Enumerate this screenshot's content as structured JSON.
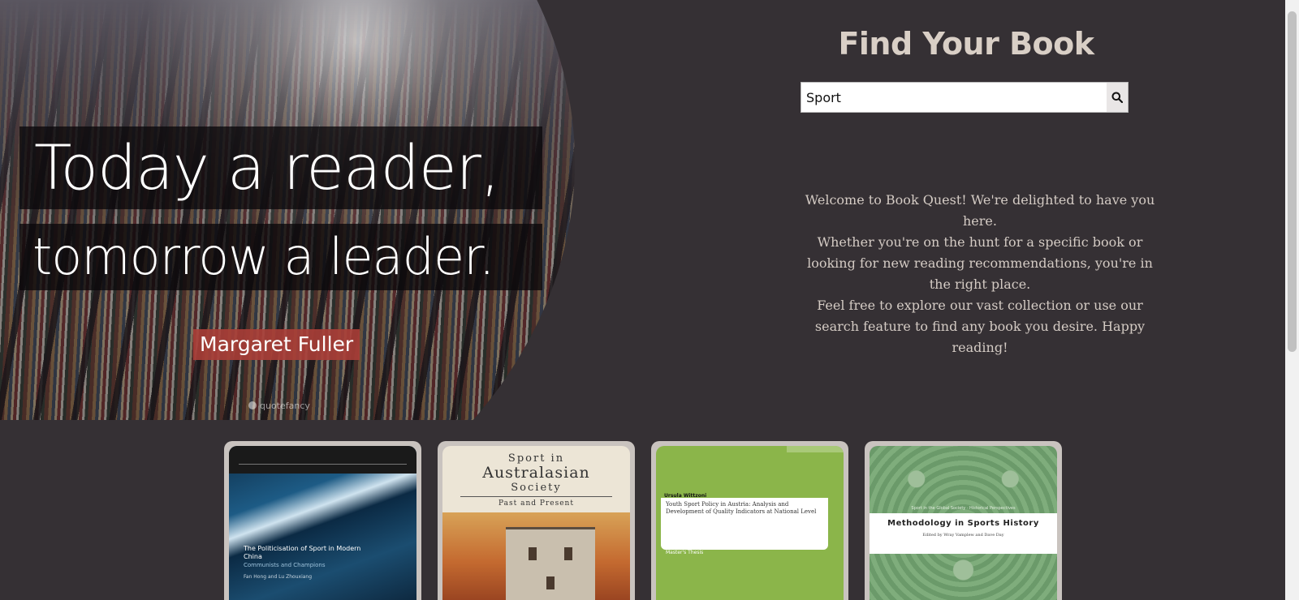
{
  "hero": {
    "quote_line1": "Today a reader,",
    "quote_line2": "tomorrow a leader.",
    "author": "Margaret Fuller",
    "watermark": "quotefancy"
  },
  "header": {
    "title": "Find Your Book"
  },
  "search": {
    "value": "Sport",
    "placeholder": ""
  },
  "welcome": {
    "line1": "Welcome to Book Quest! We're delighted to have you here.",
    "line2": "Whether you're on the hunt for a specific book or looking for new reading recommendations, you're in the right place.",
    "line3": "Feel free to explore our vast collection or use our search feature to find any book you desire. Happy reading!"
  },
  "books": [
    {
      "title": "The Politicisation of Sport in Modern China",
      "subtitle": "Communists and Champions",
      "authors": "Fan Hong and Lu Zhouxiang"
    },
    {
      "line1": "Sport in",
      "line2": "Australasian",
      "line3": "Society",
      "line4": "Past and Present"
    },
    {
      "author": "Ursula Wittzoni",
      "title": "Youth Sport Policy in Austria: Analysis and Development of Quality Indicators at National Level",
      "footer": "Master's Thesis"
    },
    {
      "series": "Sport in the Global Society · Historical Perspectives",
      "title": "Methodology in Sports History",
      "editors": "Edited by Wray Vamplew and Dave Day"
    }
  ]
}
